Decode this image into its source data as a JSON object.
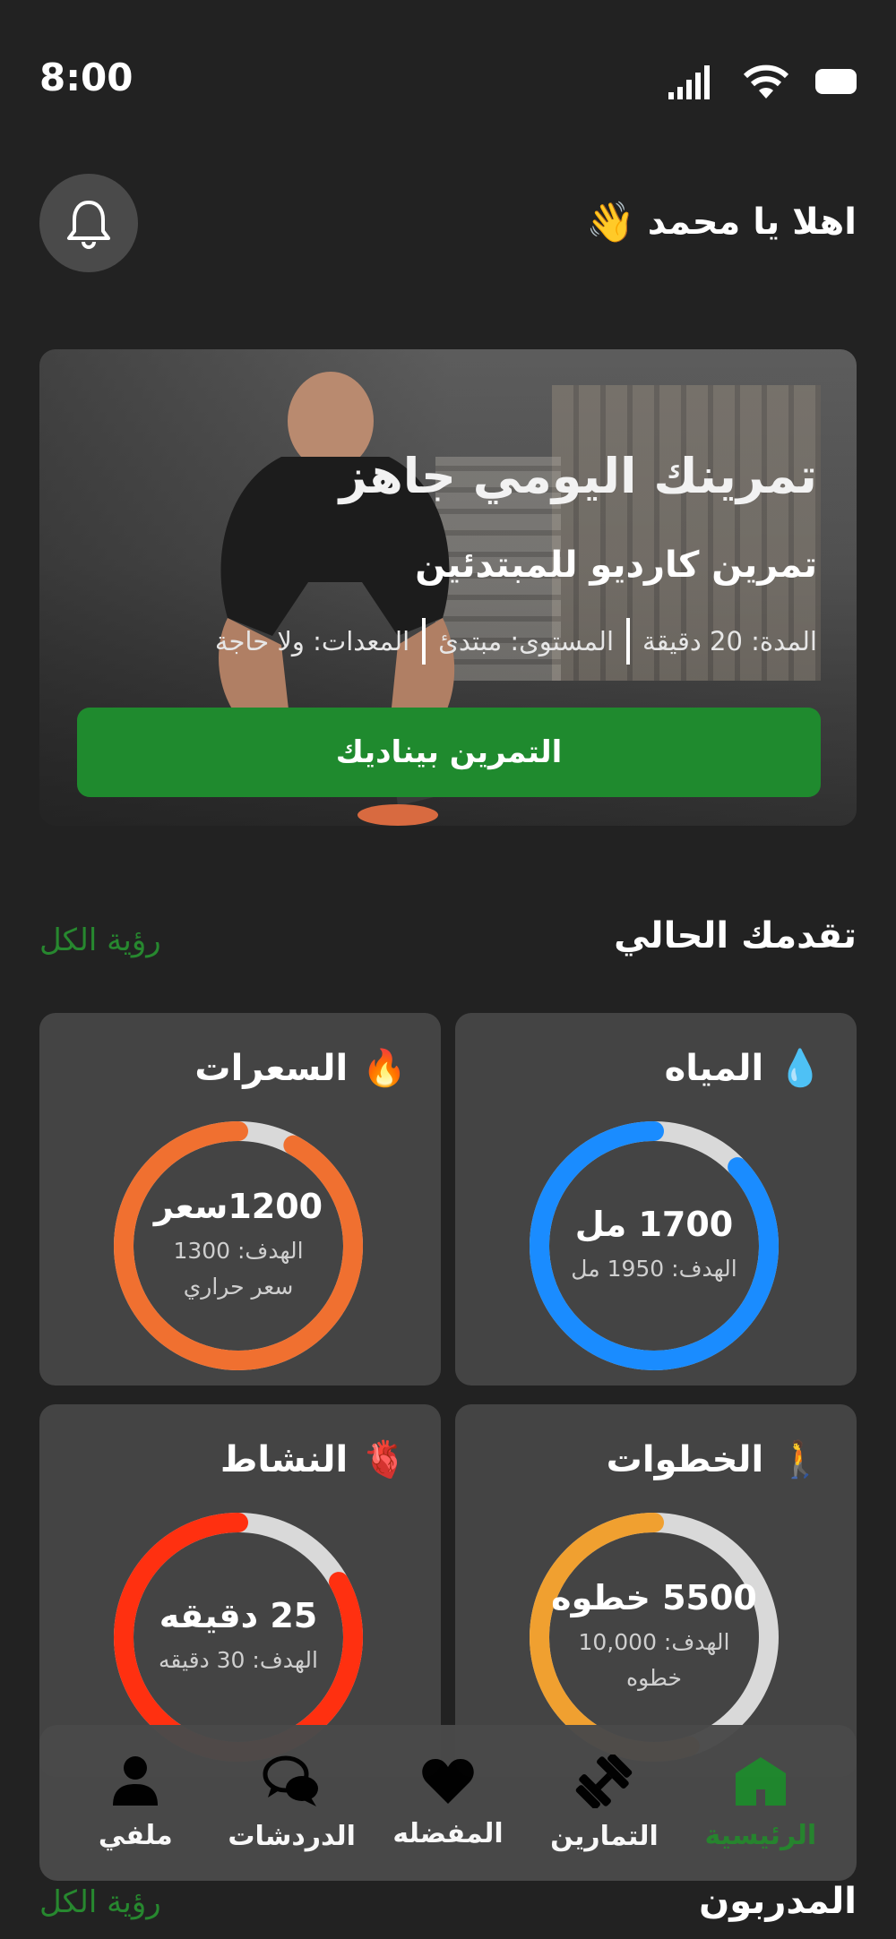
{
  "status": {
    "time": "8:00"
  },
  "header": {
    "greeting": "اهلا يا محمد",
    "wave_emoji": "👋"
  },
  "hero": {
    "title": "تمرينك اليومي جاهز",
    "subtitle": "تمرين كارديو للمبتدئين",
    "duration": "المدة: 20 دقيقة",
    "level": "المستوى: مبتدئ",
    "equipment": "المعدات: ولا حاجة",
    "cta": "التمرين بيناديك"
  },
  "progress": {
    "title": "تقدمك الحالي",
    "see_all": "رؤية الكل",
    "cards": [
      {
        "name": "المياه",
        "icon": "water-drop-icon",
        "glyph": "💧",
        "value": "1700 مل",
        "goal": "الهدف: 1950 مل",
        "fraction": 0.87,
        "color": "#1a8cff"
      },
      {
        "name": "السعرات",
        "icon": "fire-icon",
        "glyph": "🔥",
        "value": "1200سعر",
        "goal": "الهدف: 1300 سعر حراري",
        "fraction": 0.92,
        "color": "#f07030"
      },
      {
        "name": "الخطوات",
        "icon": "walking-icon",
        "glyph": "🚶",
        "value": "5500 خطوه",
        "goal": "الهدف: 10,000 خطوه",
        "fraction": 0.55,
        "color": "#f0a030"
      },
      {
        "name": "النشاط",
        "icon": "anatomical-heart-icon",
        "glyph": "🫀",
        "value": "25 دقيقه",
        "goal": "الهدف: 30 دقيقه",
        "fraction": 0.83,
        "color": "#ff3010"
      }
    ]
  },
  "trainers": {
    "title": "المدربون",
    "see_all": "رؤية الكل"
  },
  "nav": {
    "items": [
      {
        "label": "الرئيسية",
        "icon": "home-icon",
        "active": true
      },
      {
        "label": "التمارين",
        "icon": "dumbbell-icon",
        "active": false
      },
      {
        "label": "المفضله",
        "icon": "heart-icon",
        "active": false
      },
      {
        "label": "الدردشات",
        "icon": "chat-bubbles-icon",
        "active": false
      },
      {
        "label": "ملفي",
        "icon": "person-icon",
        "active": false
      }
    ]
  },
  "colors": {
    "accent": "#1f8a2e",
    "background": "#222222",
    "card": "#444444"
  }
}
